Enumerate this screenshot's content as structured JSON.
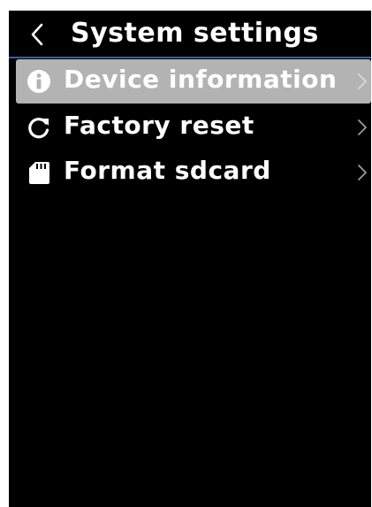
{
  "header": {
    "title": "System settings",
    "back_icon": "chevron-left-icon"
  },
  "menu": {
    "items": [
      {
        "label": "Device information",
        "icon": "info-icon",
        "selected": true
      },
      {
        "label": "Factory reset",
        "icon": "reset-icon",
        "selected": false
      },
      {
        "label": "Format sdcard",
        "icon": "sdcard-icon",
        "selected": false
      }
    ]
  },
  "colors": {
    "background": "#000000",
    "text": "#ffffff",
    "selected_background": "#b3b3b3",
    "divider": "#3a5fa8",
    "chevron": "#9a9a9a"
  }
}
